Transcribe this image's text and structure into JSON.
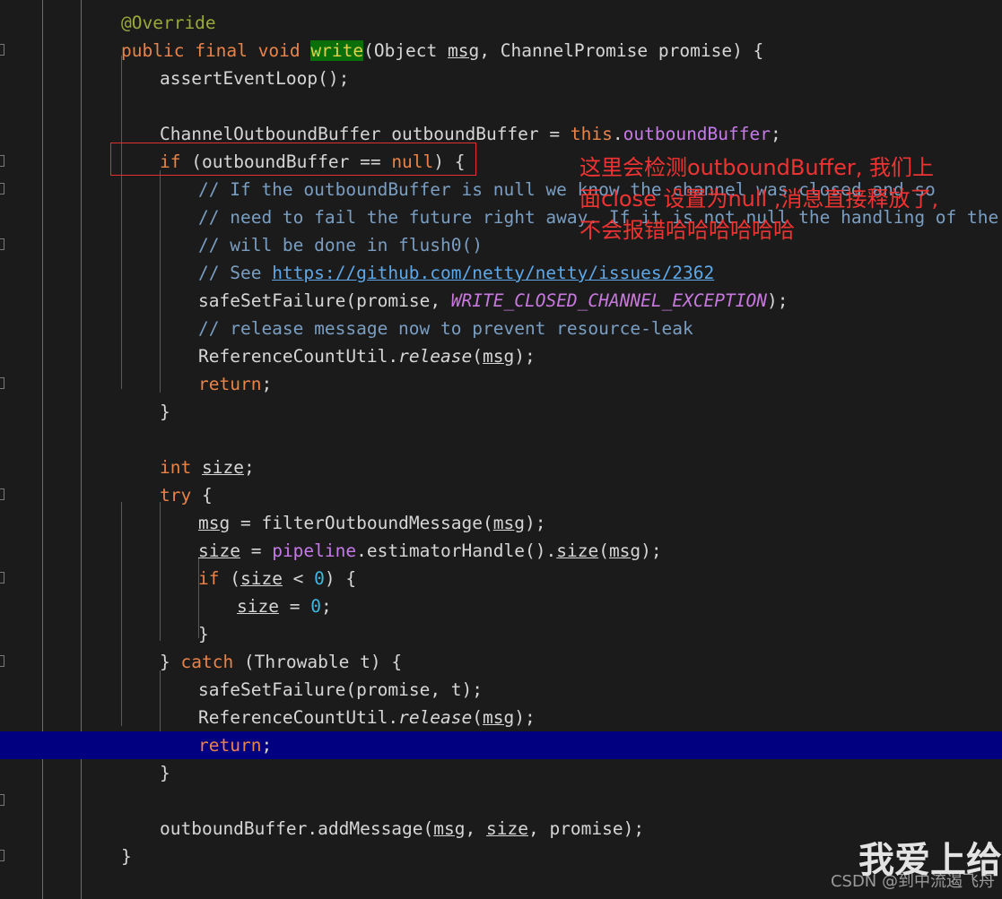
{
  "editor": {
    "background": "#1b1b1b",
    "foreground": "#d6d6d6",
    "highlight_line_color": "#000080",
    "search_hit_color": "#0a6e0a",
    "annotation_color": "#ee3333",
    "comment_color": "#7a9ec2",
    "keyword_color": "#e8834a",
    "field_color": "#c67ae8",
    "number_color": "#3fb8e0",
    "line_height_px": 31,
    "font_size_px": 19.5
  },
  "code": {
    "language": "java",
    "highlighted_line_index": 26,
    "search_term": "write",
    "lines": [
      {
        "i": 0,
        "indent": 1,
        "text": "@Override"
      },
      {
        "i": 1,
        "indent": 1,
        "text": "public final void write(Object msg, ChannelPromise promise) {"
      },
      {
        "i": 2,
        "indent": 2,
        "text": "assertEventLoop();"
      },
      {
        "i": 3,
        "indent": 0,
        "text": ""
      },
      {
        "i": 4,
        "indent": 2,
        "text": "ChannelOutboundBuffer outboundBuffer = this.outboundBuffer;"
      },
      {
        "i": 5,
        "indent": 2,
        "text": "if (outboundBuffer == null) {"
      },
      {
        "i": 6,
        "indent": 3,
        "text": "// If the outboundBuffer is null we know the channel was closed and so"
      },
      {
        "i": 7,
        "indent": 3,
        "text": "// need to fail the future right away. If it is not null the handling of the rest"
      },
      {
        "i": 8,
        "indent": 3,
        "text": "// will be done in flush0()"
      },
      {
        "i": 9,
        "indent": 3,
        "text": "// See https://github.com/netty/netty/issues/2362"
      },
      {
        "i": 10,
        "indent": 3,
        "text": "safeSetFailure(promise, WRITE_CLOSED_CHANNEL_EXCEPTION);"
      },
      {
        "i": 11,
        "indent": 3,
        "text": "// release message now to prevent resource-leak"
      },
      {
        "i": 12,
        "indent": 3,
        "text": "ReferenceCountUtil.release(msg);"
      },
      {
        "i": 13,
        "indent": 3,
        "text": "return;"
      },
      {
        "i": 14,
        "indent": 2,
        "text": "}"
      },
      {
        "i": 15,
        "indent": 0,
        "text": ""
      },
      {
        "i": 16,
        "indent": 2,
        "text": "int size;"
      },
      {
        "i": 17,
        "indent": 2,
        "text": "try {"
      },
      {
        "i": 18,
        "indent": 3,
        "text": "msg = filterOutboundMessage(msg);"
      },
      {
        "i": 19,
        "indent": 3,
        "text": "size = pipeline.estimatorHandle().size(msg);"
      },
      {
        "i": 20,
        "indent": 3,
        "text": "if (size < 0) {"
      },
      {
        "i": 21,
        "indent": 4,
        "text": "size = 0;"
      },
      {
        "i": 22,
        "indent": 3,
        "text": "}"
      },
      {
        "i": 23,
        "indent": 2,
        "text": "} catch (Throwable t) {"
      },
      {
        "i": 24,
        "indent": 3,
        "text": "safeSetFailure(promise, t);"
      },
      {
        "i": 25,
        "indent": 3,
        "text": "ReferenceCountUtil.release(msg);"
      },
      {
        "i": 26,
        "indent": 3,
        "text": "return;"
      },
      {
        "i": 27,
        "indent": 2,
        "text": "}"
      },
      {
        "i": 28,
        "indent": 0,
        "text": ""
      },
      {
        "i": 29,
        "indent": 2,
        "text": "outboundBuffer.addMessage(msg, size, promise);"
      },
      {
        "i": 30,
        "indent": 1,
        "text": "}"
      }
    ],
    "url_in_comment": "https://github.com/netty/netty/issues/2362"
  },
  "annotation": {
    "box_label": "red-rectangle-around-null-check",
    "note_lines": [
      "这里会检测outboundBuffer, 我们上",
      "面close 设置为null ,消息直接释放了,",
      "不会报错哈哈哈哈哈哈"
    ]
  },
  "watermark": {
    "big_text": "我爱上给",
    "csdn_text": "CSDN @到中流遏飞舟"
  }
}
